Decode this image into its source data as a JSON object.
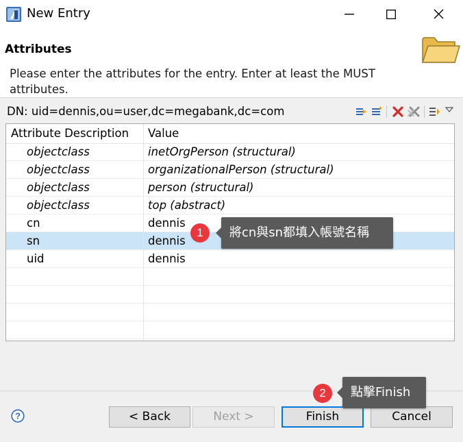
{
  "window": {
    "title": "New Entry"
  },
  "header": {
    "title": "Attributes",
    "description": "Please enter the attributes for the entry. Enter at least the MUST attributes."
  },
  "dn": {
    "label": "DN: uid=dennis,ou=user,dc=megabank,dc=com"
  },
  "toolbar": {
    "icons": [
      "new-attribute-icon",
      "new-value-icon",
      "delete-icon",
      "delete-all-icon",
      "sort-icon",
      "menu-dropdown-icon"
    ]
  },
  "table": {
    "columns": [
      "Attribute Description",
      "Value"
    ],
    "rows": [
      {
        "attr": "objectclass",
        "value": "inetOrgPerson (structural)",
        "italic": true,
        "selected": false
      },
      {
        "attr": "objectclass",
        "value": "organizationalPerson (structural)",
        "italic": true,
        "selected": false
      },
      {
        "attr": "objectclass",
        "value": "person (structural)",
        "italic": true,
        "selected": false
      },
      {
        "attr": "objectclass",
        "value": "top (abstract)",
        "italic": true,
        "selected": false
      },
      {
        "attr": "cn",
        "value": "dennis",
        "italic": false,
        "selected": false
      },
      {
        "attr": "sn",
        "value": "dennis",
        "italic": false,
        "selected": true
      },
      {
        "attr": "uid",
        "value": "dennis",
        "italic": false,
        "selected": false
      },
      {
        "attr": "",
        "value": "",
        "italic": false,
        "selected": false
      },
      {
        "attr": "",
        "value": "",
        "italic": false,
        "selected": false
      },
      {
        "attr": "",
        "value": "",
        "italic": false,
        "selected": false
      },
      {
        "attr": "",
        "value": "",
        "italic": false,
        "selected": false
      }
    ]
  },
  "callouts": [
    {
      "number": "1",
      "text": "將cn與sn都填入帳號名稱"
    },
    {
      "number": "2",
      "text": "點擊Finish"
    }
  ],
  "buttons": {
    "back": "< Back",
    "next": "Next >",
    "finish": "Finish",
    "cancel": "Cancel"
  },
  "colors": {
    "selection": "#cce4f7",
    "badge": "#e8383d",
    "tooltip": "#5a5a5a",
    "default_button_border": "#0078d7"
  }
}
